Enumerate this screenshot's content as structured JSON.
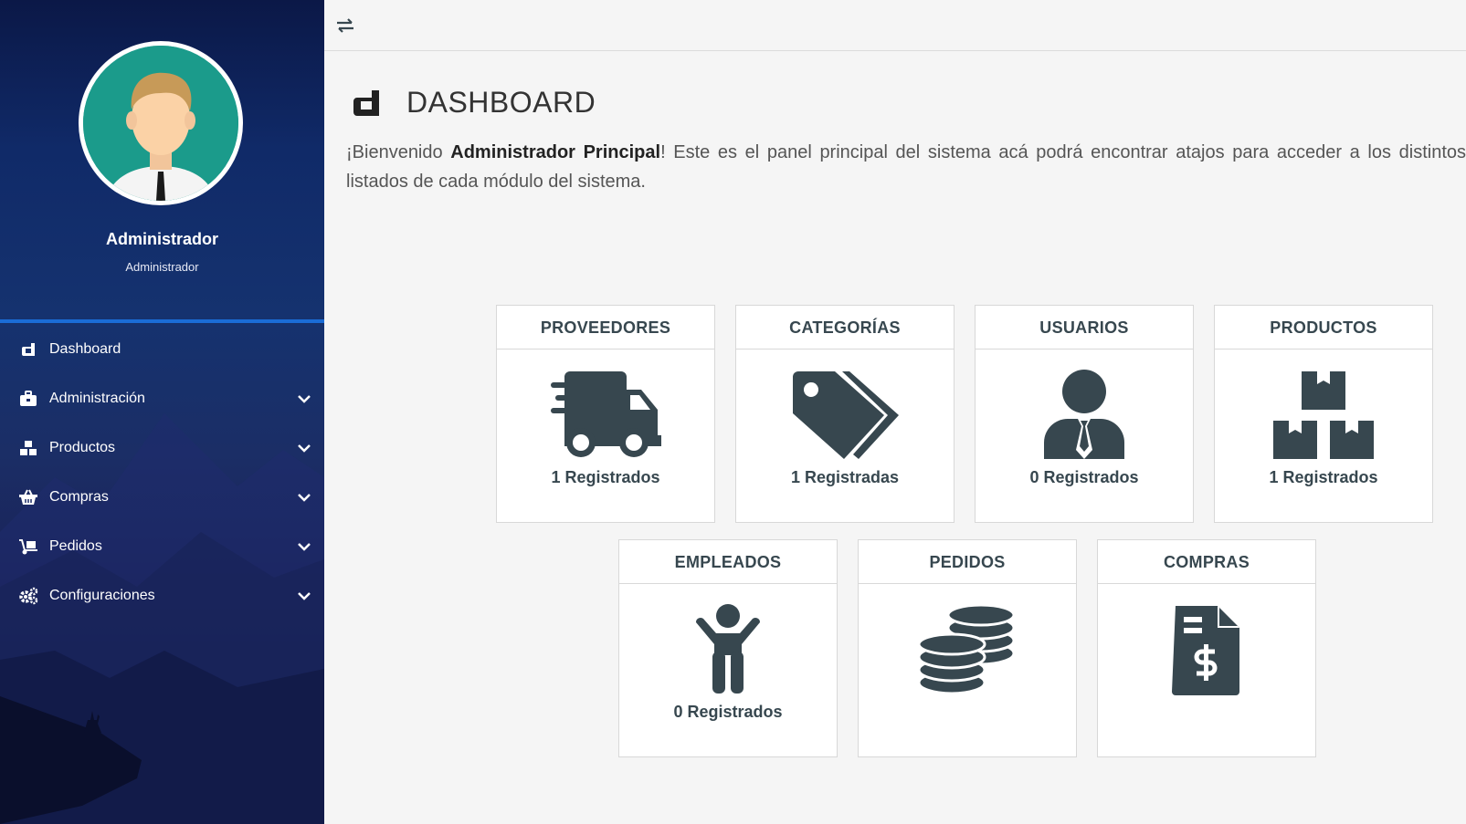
{
  "sidebar": {
    "user_name": "Administrador",
    "user_role": "Administrador",
    "items": [
      {
        "label": "Dashboard",
        "icon": "dashboard-icon"
      },
      {
        "label": "Administración",
        "icon": "briefcase-icon"
      },
      {
        "label": "Productos",
        "icon": "boxes-icon"
      },
      {
        "label": "Compras",
        "icon": "basket-icon"
      },
      {
        "label": "Pedidos",
        "icon": "dolly-icon"
      },
      {
        "label": "Configuraciones",
        "icon": "cogs-icon"
      }
    ]
  },
  "header": {
    "title": "DASHBOARD",
    "welcome_prefix": "¡Bienvenido ",
    "welcome_name": "Administrador Principal",
    "welcome_suffix": "! Este es el panel principal del sistema acá podrá encontrar atajos para acceder a los distintos listados de cada módulo del sistema."
  },
  "tiles": [
    {
      "title": "PROVEEDORES",
      "count": "1 Registrados",
      "icon": "truck-icon"
    },
    {
      "title": "CATEGORÍAS",
      "count": "1 Registradas",
      "icon": "tags-icon"
    },
    {
      "title": "USUARIOS",
      "count": "0 Registrados",
      "icon": "user-tie-icon"
    },
    {
      "title": "PRODUCTOS",
      "count": "1 Registrados",
      "icon": "boxes-icon"
    },
    {
      "title": "EMPLEADOS",
      "count": "0 Registrados",
      "icon": "child-icon"
    },
    {
      "title": "PEDIDOS",
      "count": "",
      "icon": "coins-icon"
    },
    {
      "title": "COMPRAS",
      "count": "",
      "icon": "file-invoice-dollar-icon"
    }
  ],
  "colors": {
    "sidebar_accent": "#1a6cd6",
    "tile_text": "#37474f",
    "icon_fill": "#37474f"
  }
}
